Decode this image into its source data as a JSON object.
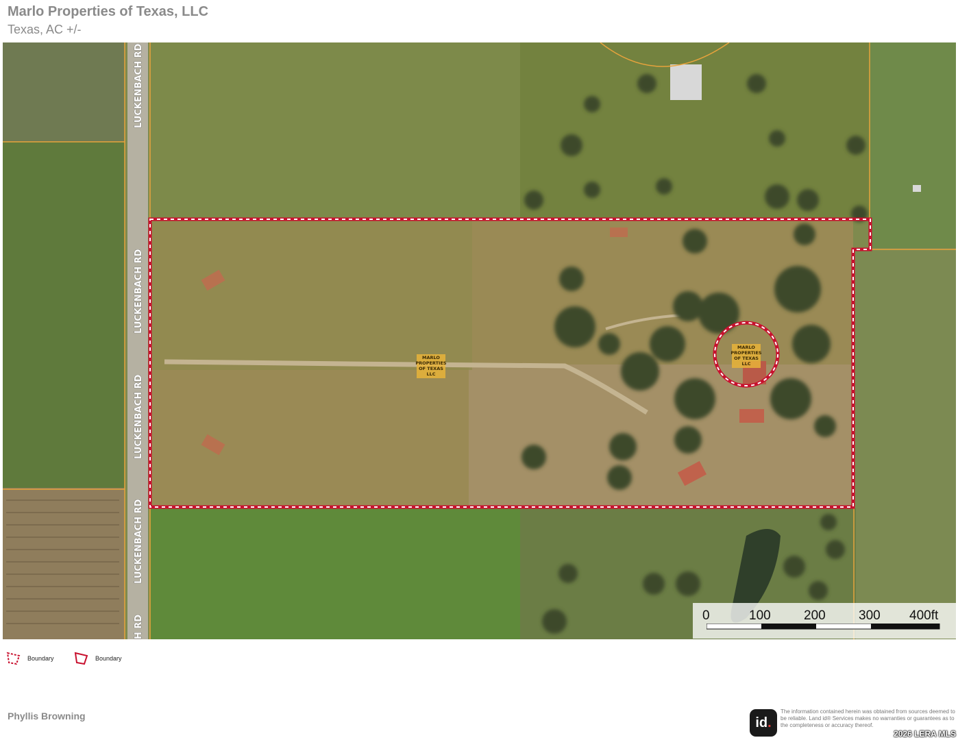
{
  "header": {
    "title": "Marlo Properties of Texas, LLC",
    "subtitle": "Texas,  AC +/-"
  },
  "map": {
    "road_label": "LUCKENBACH RD",
    "road_label_partial": "H RD",
    "parcel_label": [
      "MARLO",
      "PROPERTIES",
      "OF TEXAS",
      "LLC"
    ],
    "boundary_color": "#c8102e",
    "parcel_line_color": "#e8a33c",
    "scale": {
      "ticks": [
        "0",
        "100",
        "200",
        "300",
        "400ft"
      ]
    }
  },
  "legend": {
    "items": [
      {
        "label": "Boundary",
        "icon": "dashed-boundary-icon"
      },
      {
        "label": "Boundary",
        "icon": "solid-boundary-icon"
      }
    ]
  },
  "footer": {
    "agent_name": "Phyllis Browning",
    "logo_text": "id",
    "logo_dot": ".",
    "disclaimer": "The information contained herein was obtained from sources deemed to be reliable. Land id® Services makes no warranties or guarantees as to the completeness or accuracy thereof.",
    "mls": "2026 LERA MLS"
  }
}
